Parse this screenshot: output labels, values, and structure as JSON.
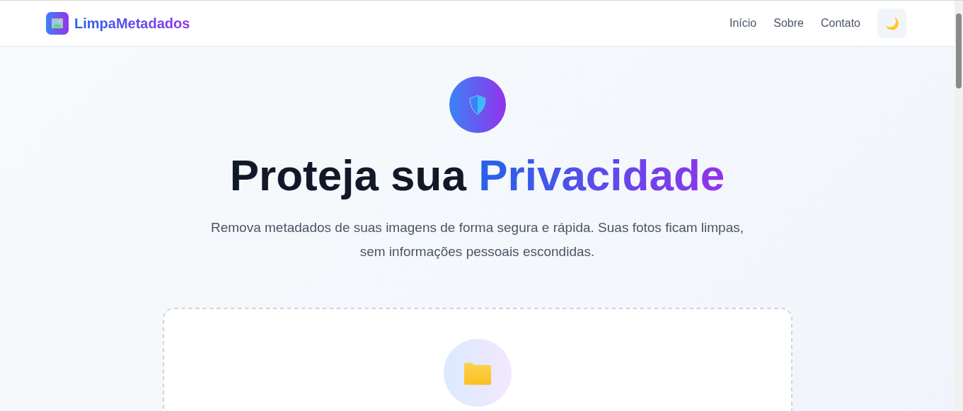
{
  "header": {
    "brand": "LimpaMetadados",
    "nav": [
      {
        "label": "Início"
      },
      {
        "label": "Sobre"
      },
      {
        "label": "Contato"
      }
    ],
    "theme_toggle": "🌙"
  },
  "hero": {
    "title": "Proteja sua",
    "title_highlight": "Privacidade",
    "subtitle": "Remova metadados de suas imagens de forma segura e rápida. Suas fotos ficam limpas, sem informações pessoais escondidas."
  },
  "upload": {
    "kind": "dropzone"
  }
}
